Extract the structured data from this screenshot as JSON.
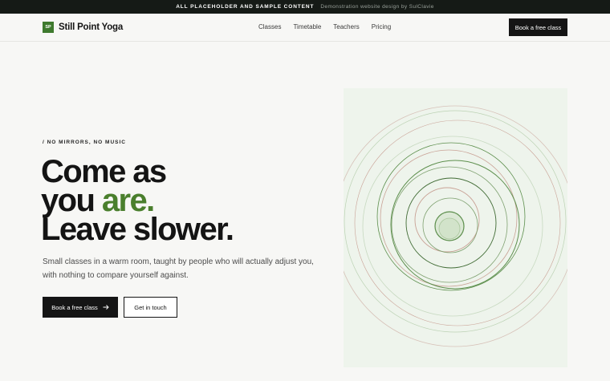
{
  "banner": {
    "label": "ALL PLACEHOLDER AND SAMPLE CONTENT",
    "credit": "Demonstration website design by SulClavie"
  },
  "header": {
    "logo_mark": "SP",
    "brand": "Still Point Yoga",
    "nav": [
      "Classes",
      "Timetable",
      "Teachers",
      "Pricing"
    ],
    "cta": "Book a free class"
  },
  "hero": {
    "eyebrow": "/ NO MIRRORS, NO MUSIC",
    "headline_line1": "Come as",
    "headline_line2_pre": "you ",
    "headline_line2_accent": "are.",
    "headline_line3": "Leave slower.",
    "lede": "Small classes in a warm room, taught by people who will actually adjust you, with nothing to compare yourself against.",
    "primary_cta": "Book a free class",
    "primary_cta_icon": "arrow-right-icon",
    "secondary_cta": "Get in touch"
  },
  "colors": {
    "accent_green": "#4a7f2d",
    "dark": "#151515",
    "background": "#f7f7f5",
    "art_background": "#eef4ec",
    "ring_green": "#5d8f4d",
    "ring_rose": "#c9a296"
  }
}
